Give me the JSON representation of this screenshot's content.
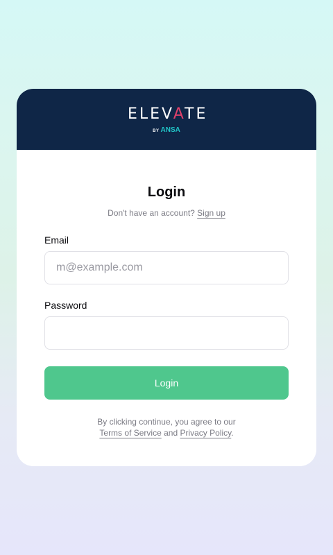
{
  "brand": {
    "logo_word_part1": "ELEV",
    "logo_word_accent": "A",
    "logo_word_part2": "TE",
    "logo_by": "BY",
    "logo_brand": "ANSA",
    "header_color": "#0f2647",
    "accent_color": "#e0406a",
    "brand_color": "#21c5c8"
  },
  "login": {
    "title": "Login",
    "signup_prompt": "Don't have an account?",
    "signup_link": "Sign up",
    "email_label": "Email",
    "email_placeholder": "m@example.com",
    "email_value": "",
    "password_label": "Password",
    "password_value": "",
    "submit_label": "Login",
    "submit_color": "#4fc78d",
    "terms_prefix": "By clicking continue, you agree to our",
    "terms_link": "Terms of Service",
    "terms_and": "and",
    "privacy_link": "Privacy Policy",
    "terms_suffix": "."
  }
}
